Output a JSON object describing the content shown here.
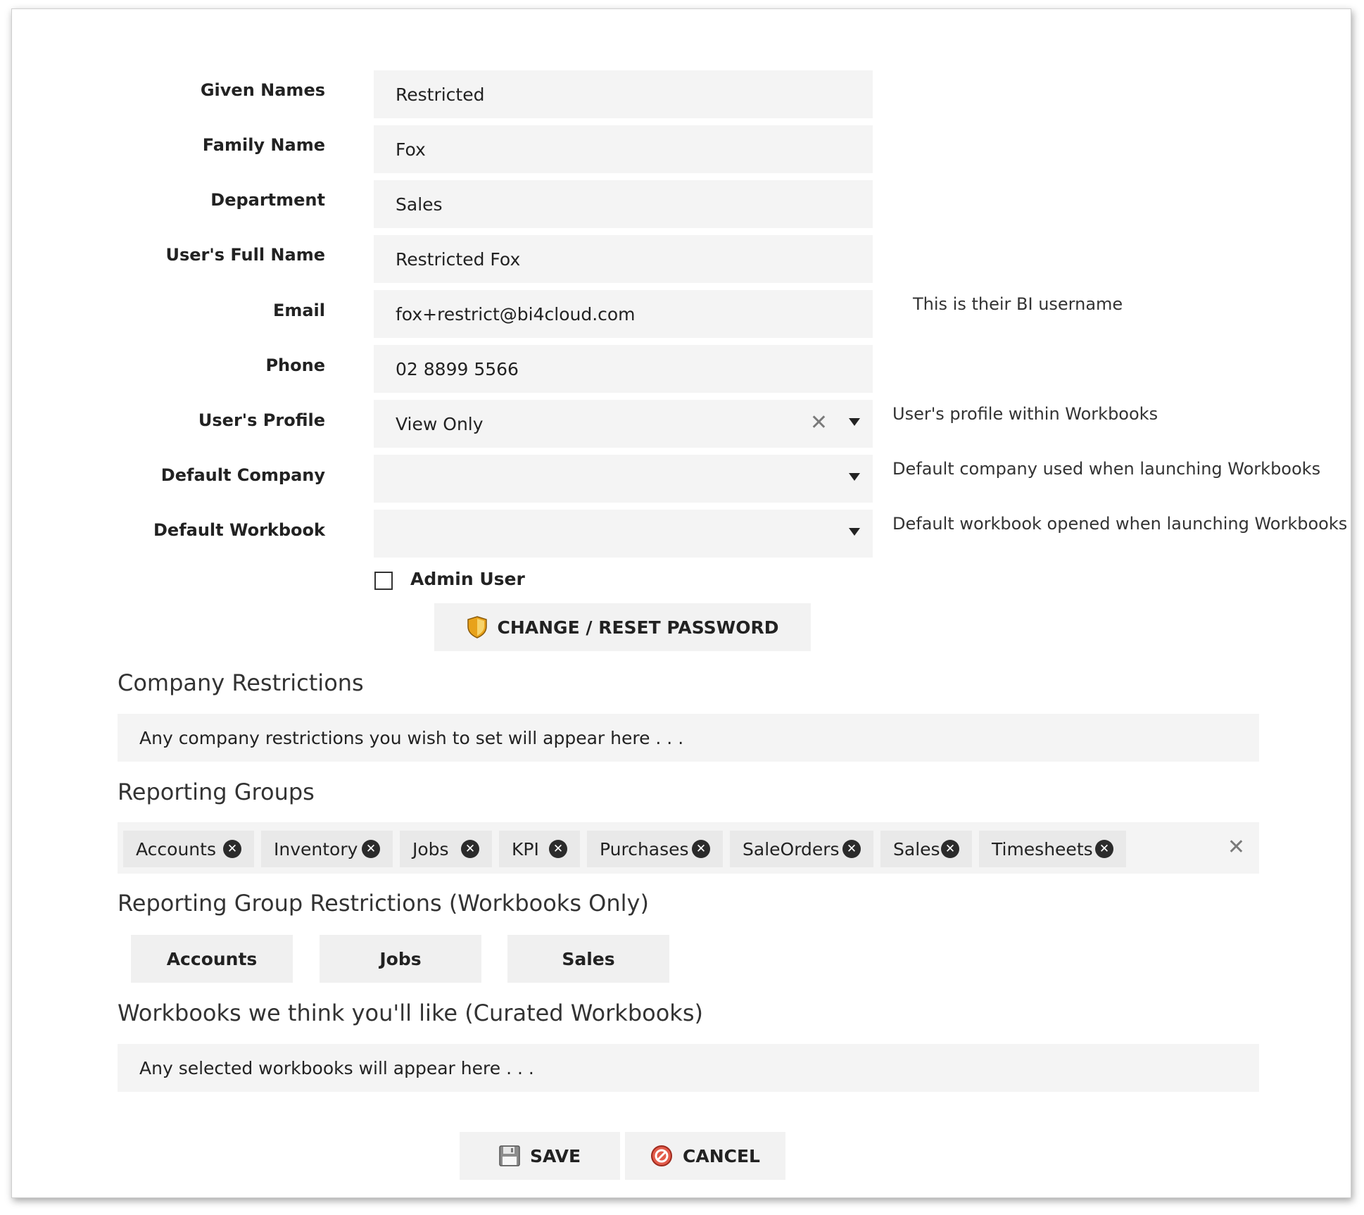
{
  "form": {
    "given_names": {
      "label": "Given Names",
      "value": "Restricted"
    },
    "family_name": {
      "label": "Family Name",
      "value": "Fox"
    },
    "department": {
      "label": "Department",
      "value": "Sales"
    },
    "full_name": {
      "label": "User's Full Name",
      "value": "Restricted Fox"
    },
    "email": {
      "label": "Email",
      "value": "fox+restrict@bi4cloud.com",
      "hint": "This is their BI username"
    },
    "phone": {
      "label": "Phone",
      "value": "02 8899 5566"
    },
    "profile": {
      "label": "User's Profile",
      "value": "View Only",
      "hint": "User's profile within Workbooks"
    },
    "default_company": {
      "label": "Default Company",
      "value": "",
      "hint": "Default company used when launching Workbooks"
    },
    "default_workbook": {
      "label": "Default Workbook",
      "value": "",
      "hint": "Default workbook opened when launching Workbooks"
    },
    "admin_user": {
      "label": "Admin User",
      "checked": false
    },
    "change_password_label": "CHANGE / RESET PASSWORD"
  },
  "company_restrictions": {
    "title": "Company Restrictions",
    "placeholder": "Any company restrictions you wish to set will appear here . . ."
  },
  "reporting_groups": {
    "title": "Reporting Groups",
    "tags": [
      "Accounts",
      "Inventory",
      "Jobs",
      "KPI",
      "Purchases",
      "SaleOrders",
      "Sales",
      "Timesheets"
    ]
  },
  "reporting_group_restrictions": {
    "title": "Reporting Group Restrictions (Workbooks Only)",
    "items": [
      "Accounts",
      "Jobs",
      "Sales"
    ]
  },
  "curated_workbooks": {
    "title": "Workbooks we think you'll like (Curated Workbooks)",
    "placeholder": "Any selected workbooks will appear here . . ."
  },
  "actions": {
    "save_label": "SAVE",
    "cancel_label": "CANCEL"
  },
  "icons": {
    "shield": "shield-icon",
    "save": "floppy-disk-icon",
    "cancel": "no-entry-icon",
    "remove": "remove-circle-icon",
    "clear": "clear-x-icon",
    "caret": "caret-down-icon"
  }
}
